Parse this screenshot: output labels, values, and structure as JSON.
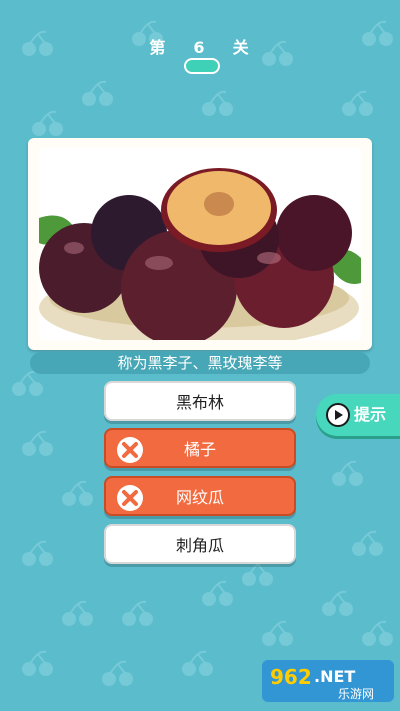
{
  "level": {
    "prefix": "第",
    "number": "6",
    "suffix": "关"
  },
  "caption": "称为黑李子、黑玫瑰李等",
  "answers": [
    {
      "label": "黑布林",
      "state": "normal"
    },
    {
      "label": "橘子",
      "state": "wrong"
    },
    {
      "label": "网纹瓜",
      "state": "wrong"
    },
    {
      "label": "刺角瓜",
      "state": "normal"
    }
  ],
  "hint": {
    "label": "提示",
    "icon": "play-icon"
  },
  "watermark": {
    "text": "962.NET",
    "subtext": "乐游网"
  },
  "colors": {
    "background": "#5bbccc",
    "wrong": "#f26a3f",
    "hint": "#47d7bc",
    "pill": "#3fd0b8"
  }
}
